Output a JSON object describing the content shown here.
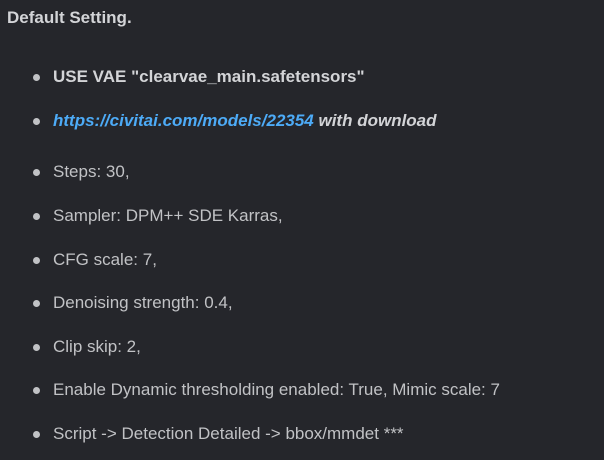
{
  "heading": "Default Setting.",
  "items": [
    {
      "text": "USE VAE \"clearvae_main.safetensors\""
    },
    {
      "link": "https://civitai.com/models/22354",
      "suffix": " with download"
    },
    {
      "text": "Steps: 30,"
    },
    {
      "text": "Sampler: DPM++ SDE Karras,"
    },
    {
      "text": "CFG scale: 7,"
    },
    {
      "text": "Denoising strength: 0.4,"
    },
    {
      "text": "Clip skip: 2,"
    },
    {
      "text": "Enable Dynamic thresholding enabled: True, Mimic scale: 7"
    },
    {
      "text": "Script -> Detection Detailed -> bbox/mmdet ***"
    }
  ]
}
